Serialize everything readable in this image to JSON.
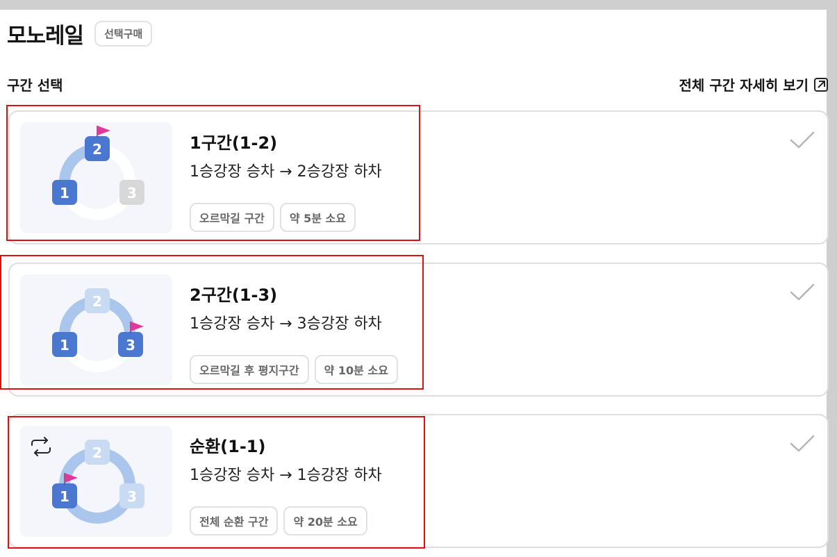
{
  "header": {
    "title": "모노레일",
    "select_chip": "선택구매"
  },
  "section": {
    "label": "구간 선택",
    "detail_link": "전체 구간 자세히 보기"
  },
  "cards": [
    {
      "title": "1구간(1-2)",
      "route": "1승강장 승차 → 2승강장 하차",
      "tags": [
        "오르막길 구간",
        "약 5분 소요"
      ],
      "stations": [
        "1",
        "2",
        "3"
      ]
    },
    {
      "title": "2구간(1-3)",
      "route": "1승강장 승차 → 3승강장 하차",
      "tags": [
        "오르막길 후 평지구간",
        "약 10분 소요"
      ],
      "stations": [
        "1",
        "2",
        "3"
      ]
    },
    {
      "title": "순환(1-1)",
      "route": "1승강장 승차 → 1승강장 하차",
      "tags": [
        "전체 순환 구간",
        "약 20분 소요"
      ],
      "stations": [
        "1",
        "2",
        "3"
      ]
    }
  ],
  "colors": {
    "active_station": "#4a78d0",
    "inactive_station": "#c9daf3",
    "disabled_station": "#d8d8d8",
    "track_active": "#aac6ec",
    "flag": "#e0399b",
    "highlight": "#e01010"
  },
  "icons": {
    "check": "check-icon",
    "external": "external-link-icon",
    "loop": "loop-icon",
    "flag": "flag-icon"
  }
}
